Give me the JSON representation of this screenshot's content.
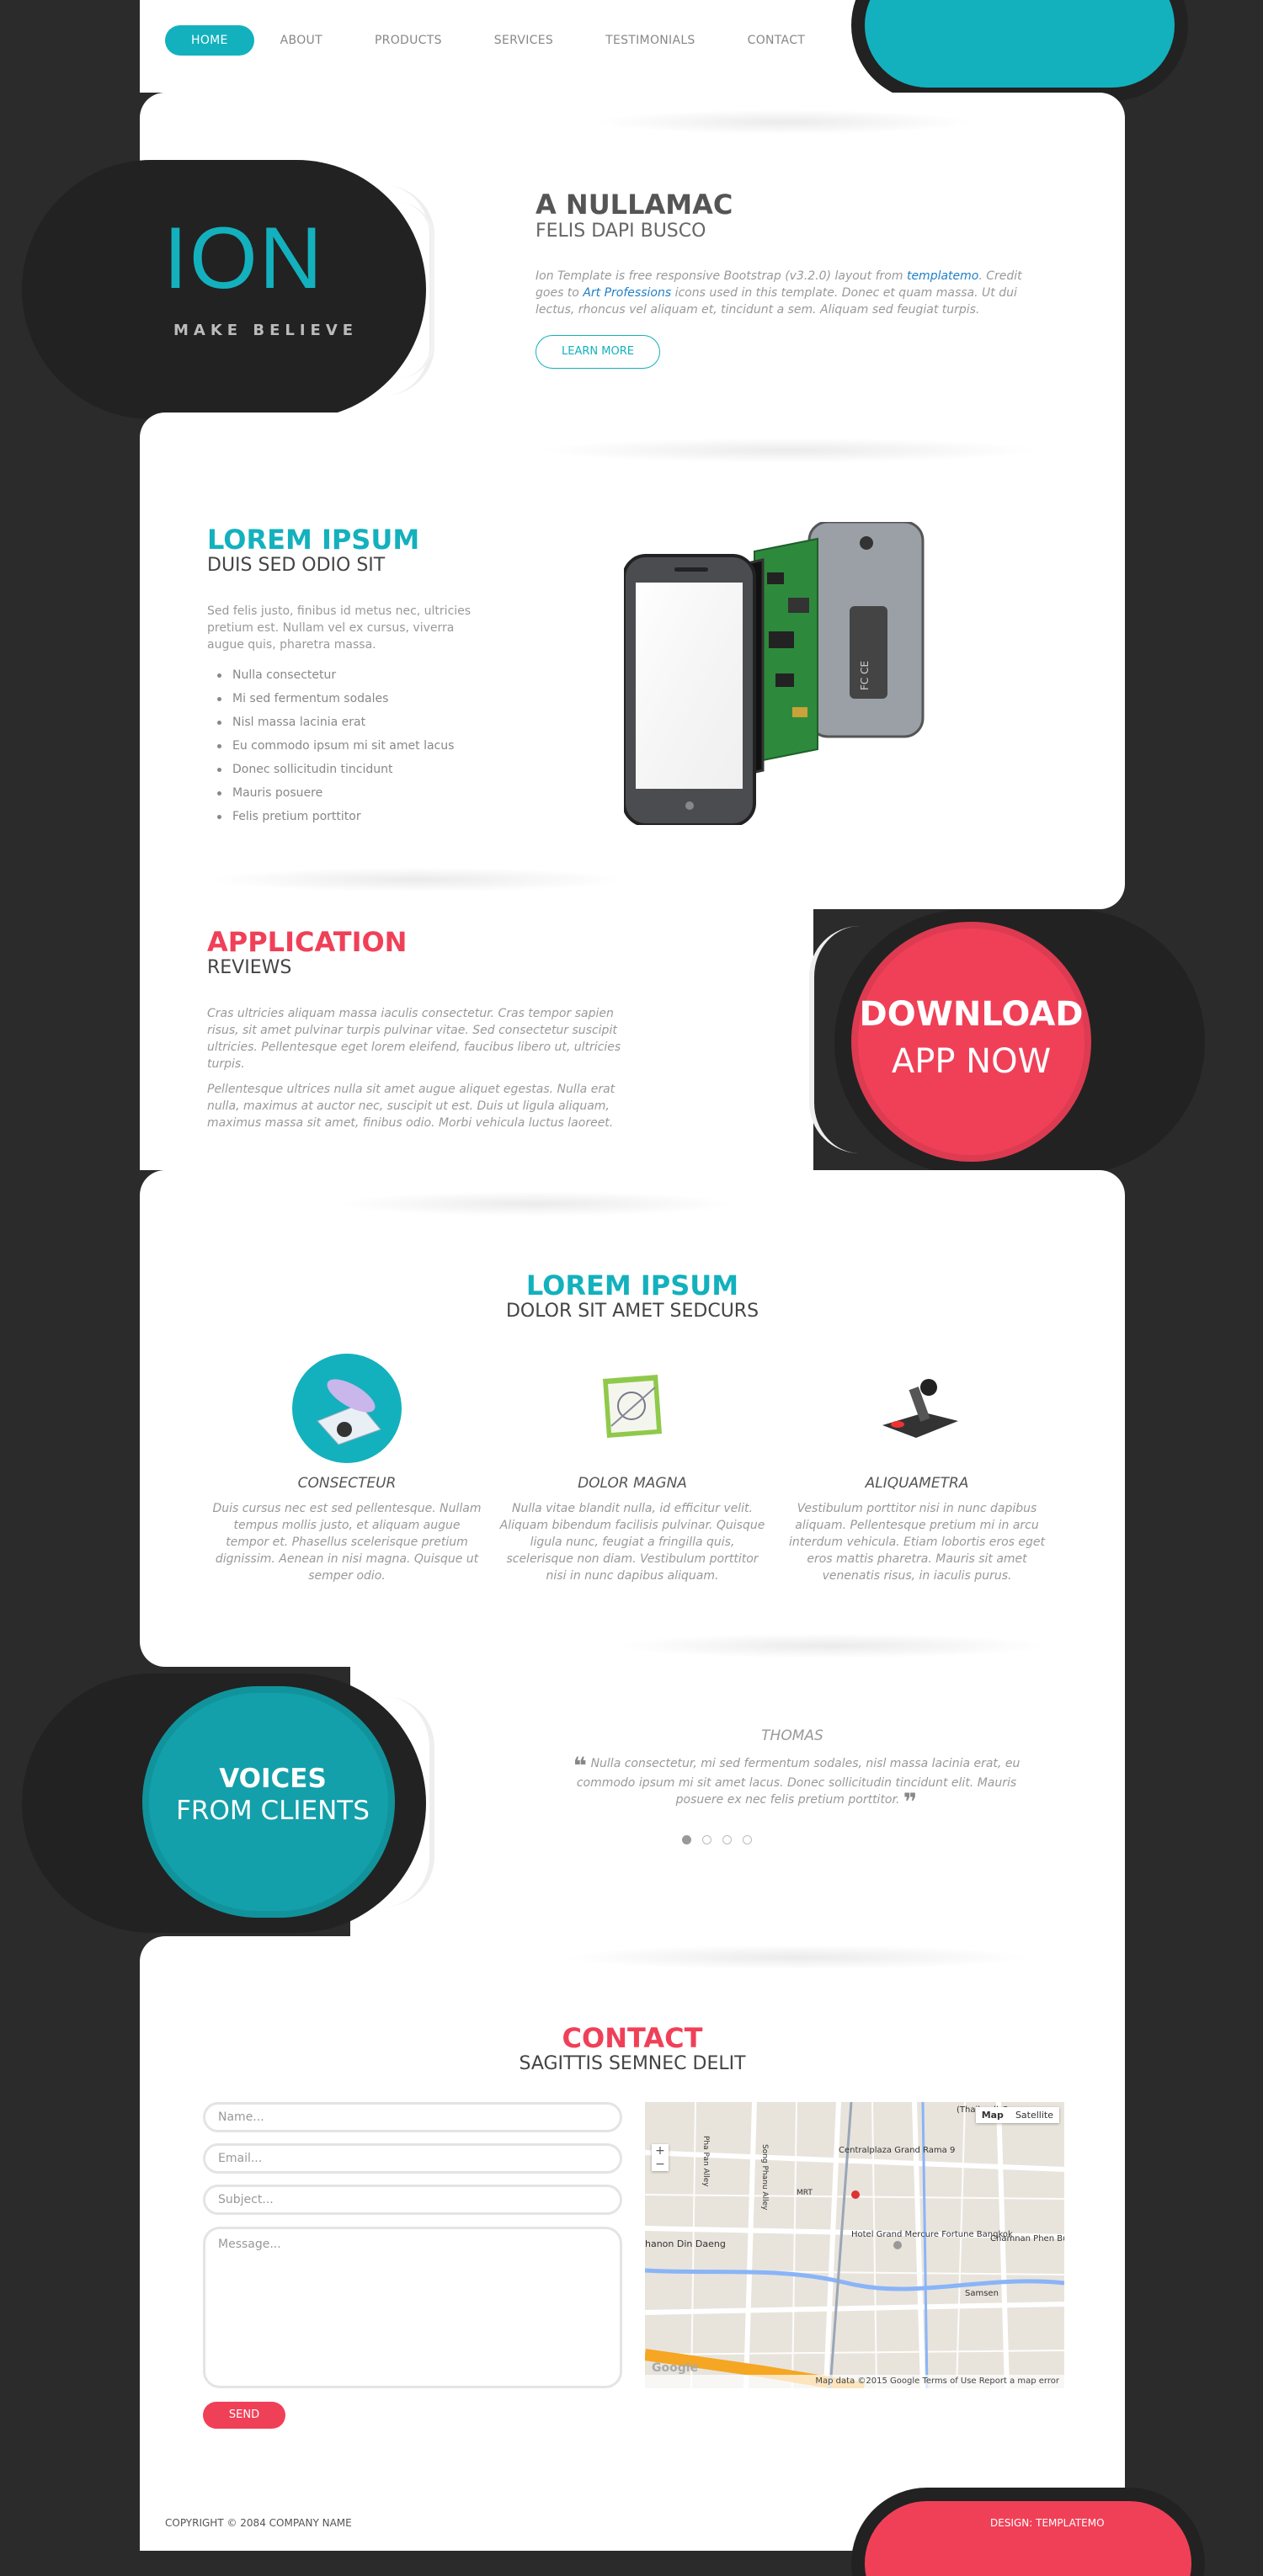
{
  "nav": {
    "items": [
      {
        "label": "HOME",
        "active": true
      },
      {
        "label": "ABOUT"
      },
      {
        "label": "PRODUCTS"
      },
      {
        "label": "SERVICES"
      },
      {
        "label": "TESTIMONIALS"
      },
      {
        "label": "CONTACT"
      }
    ]
  },
  "hero": {
    "logo": "ION",
    "tagline": "MAKE BELIEVE",
    "title": "A NULLAMAC",
    "subtitle": "FELIS DAPI BUSCO",
    "text_before_link1": "Ion Template is free responsive Bootstrap (v3.2.0) layout from ",
    "link1": "templatemo",
    "text_between": ". Credit goes to ",
    "link2": "Art Professions",
    "text_after": " icons used in this template. Donec et quam massa. Ut dui lectus, rhoncus vel aliquam et, tincidunt a sem. Aliquam sed feugiat turpis.",
    "button": "LEARN MORE"
  },
  "feature": {
    "title": "LOREM IPSUM",
    "subtitle": "DUIS SED ODIO SIT",
    "text": "Sed felis justo, finibus id metus nec, ultricies pretium est. Nullam vel ex cursus, viverra augue quis, pharetra massa.",
    "list": [
      "Nulla consectetur",
      "Mi sed fermentum sodales",
      "Nisl massa lacinia erat",
      "Eu commodo ipsum mi sit amet lacus",
      "Donec sollicitudin tincidunt",
      "Mauris posuere",
      "Felis pretium porttitor"
    ]
  },
  "app": {
    "title": "APPLICATION",
    "subtitle": "REVIEWS",
    "para1": "Cras ultricies aliquam massa iaculis consectetur. Cras tempor sapien risus, sit amet pulvinar turpis pulvinar vitae. Sed consectetur suscipit ultricies. Pellentesque eget lorem eleifend, faucibus libero ut, ultricies turpis.",
    "para2": "Pellentesque ultrices nulla sit amet augue aliquet egestas. Nulla erat nulla, maximus at auctor nec, suscipit ut est. Duis ut ligula aliquam, maximus massa sit amet, finibus odio. Morbi vehicula luctus laoreet.",
    "download1": "DOWNLOAD",
    "download2": "APP NOW"
  },
  "services": {
    "title": "LOREM IPSUM",
    "subtitle": "DOLOR SIT AMET SEDCURS",
    "cols": [
      {
        "title": "CONSECTEUR",
        "text": "Duis cursus nec est sed pellentesque. Nullam tempus mollis justo, et aliquam augue tempor et. Phasellus scelerisque pretium dignissim. Aenean in nisi magna. Quisque ut semper odio.",
        "icon": "quill-paper-icon"
      },
      {
        "title": "DOLOR MAGNA",
        "text": "Nulla vitae blandit nulla, id efficitur velit. Aliquam bibendum facilisis pulvinar. Quisque ligula nunc, feugiat a fringilla quis, scelerisque non diam. Vestibulum porttitor nisi in nunc dapibus aliquam.",
        "icon": "drawing-board-icon"
      },
      {
        "title": "ALIQUAMETRA",
        "text": "Vestibulum porttitor nisi in nunc dapibus aliquam. Pellentesque pretium mi in arcu interdum vehicula. Etiam lobortis eros eget eros mattis pharetra. Mauris sit amet venenatis risus, in iaculis purus.",
        "icon": "joystick-icon"
      }
    ]
  },
  "testimonials": {
    "label1": "VOICES",
    "label2": "FROM CLIENTS",
    "name": "THOMAS",
    "quote": "Nulla consectetur, mi sed fermentum sodales, nisl massa lacinia erat, eu commodo ipsum mi sit amet lacus. Donec sollicitudin tincidunt elit. Mauris posuere ex nec felis pretium porttitor.",
    "dots": 4,
    "active_dot": 1
  },
  "contact": {
    "title": "CONTACT",
    "subtitle": "SAGITTIS SEMNEC DELIT",
    "name_placeholder": "Name...",
    "email_placeholder": "Email...",
    "subject_placeholder": "Subject...",
    "message_placeholder": "Message...",
    "send": "SEND",
    "map": {
      "btn_map": "Map",
      "btn_satellite": "Satellite",
      "footer": "Map data ©2015 Google   Terms of Use   Report a map error",
      "logo": "Google",
      "labels": [
        "(Thailand) Co...",
        "Centralplaza Grand Rama 9",
        "MRT",
        "Hotel Grand Mercure Fortune Bangkok",
        "Chamnan Phen Business Cente",
        "hanon Din Daeng",
        "Samsen",
        "Song Phanu Alley",
        "Pha Pan Alley"
      ]
    }
  },
  "footer": {
    "copyright": "COPYRIGHT © 2084 COMPANY NAME",
    "design": "DESIGN: TEMPLATEMO"
  }
}
